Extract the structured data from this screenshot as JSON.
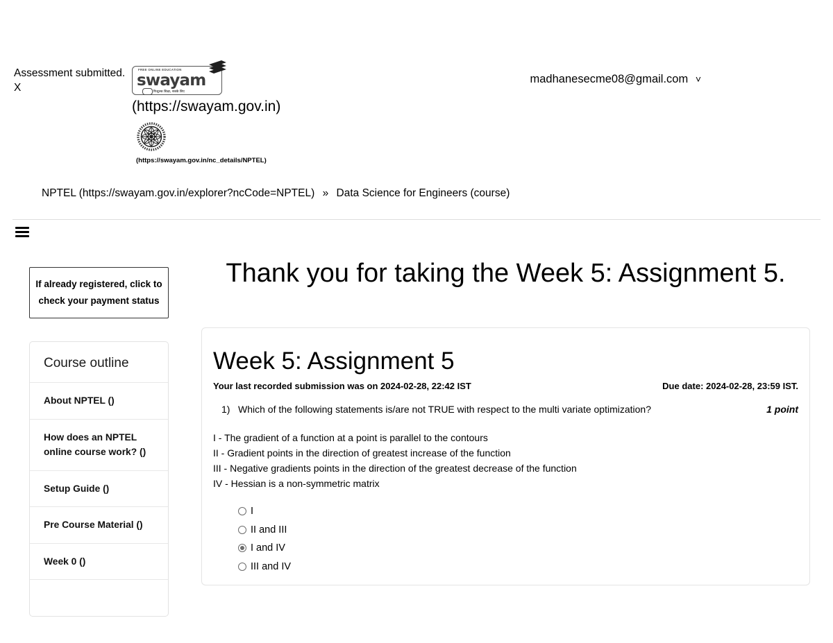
{
  "notification": {
    "message": "Assessment submitted.",
    "close_label": "X"
  },
  "header": {
    "swayam_logo": {
      "tagline_top": "FREE ONLINE EDUCATION",
      "wordmark": "swayam",
      "tagline_bottom": "निःशुल्क शिक्षा, सबके लिए"
    },
    "swayam_url": "(https://swayam.gov.in)",
    "nptel_url": "(https://swayam.gov.in/nc_details/NPTEL)",
    "account_email": "madhanesecme08@gmail.com"
  },
  "breadcrumb": {
    "root": "NPTEL (https://swayam.gov.in/explorer?ncCode=NPTEL)",
    "separator": "»",
    "current": "Data Science for Engineers (course)"
  },
  "sidebar": {
    "payment_notice": "If already registered, click to check your payment status",
    "outline_title": "Course outline",
    "items": [
      {
        "label": "About NPTEL ()"
      },
      {
        "label": "How does an NPTEL online course work? ()"
      },
      {
        "label": "Setup Guide ()"
      },
      {
        "label": "Pre Course Material ()"
      },
      {
        "label": "Week 0 ()"
      }
    ]
  },
  "main": {
    "thanks_heading": "Thank you for taking the Week 5: Assignment 5.",
    "quiz_title": "Week 5: Assignment 5",
    "last_submission": "Your last recorded submission was on 2024-02-28, 22:42 IST",
    "due_date": "Due date: 2024-02-28, 23:59 IST.",
    "question": {
      "number": "1)",
      "text": "Which of the following statements is/are not TRUE with respect to the multi variate optimization?",
      "points": "1 point",
      "statements": [
        "I - The gradient of a function at a point is parallel to the contours",
        "II - Gradient points in the direction of greatest increase of the function",
        "III - Negative gradients points in the direction of the greatest decrease of the function",
        "IV - Hessian is a non-symmetric matrix"
      ],
      "options": [
        {
          "label": "I",
          "selected": false
        },
        {
          "label": "II and III",
          "selected": false
        },
        {
          "label": "I and IV",
          "selected": true
        },
        {
          "label": "III and IV",
          "selected": false
        }
      ]
    }
  },
  "icons": {
    "menu": "hamburger-icon",
    "chevron": "˅"
  },
  "colors": {
    "background": "#ffffff",
    "text": "#000000",
    "border": "#e4e4e4",
    "divider": "#dedede",
    "radio": "#6b6b6b"
  }
}
